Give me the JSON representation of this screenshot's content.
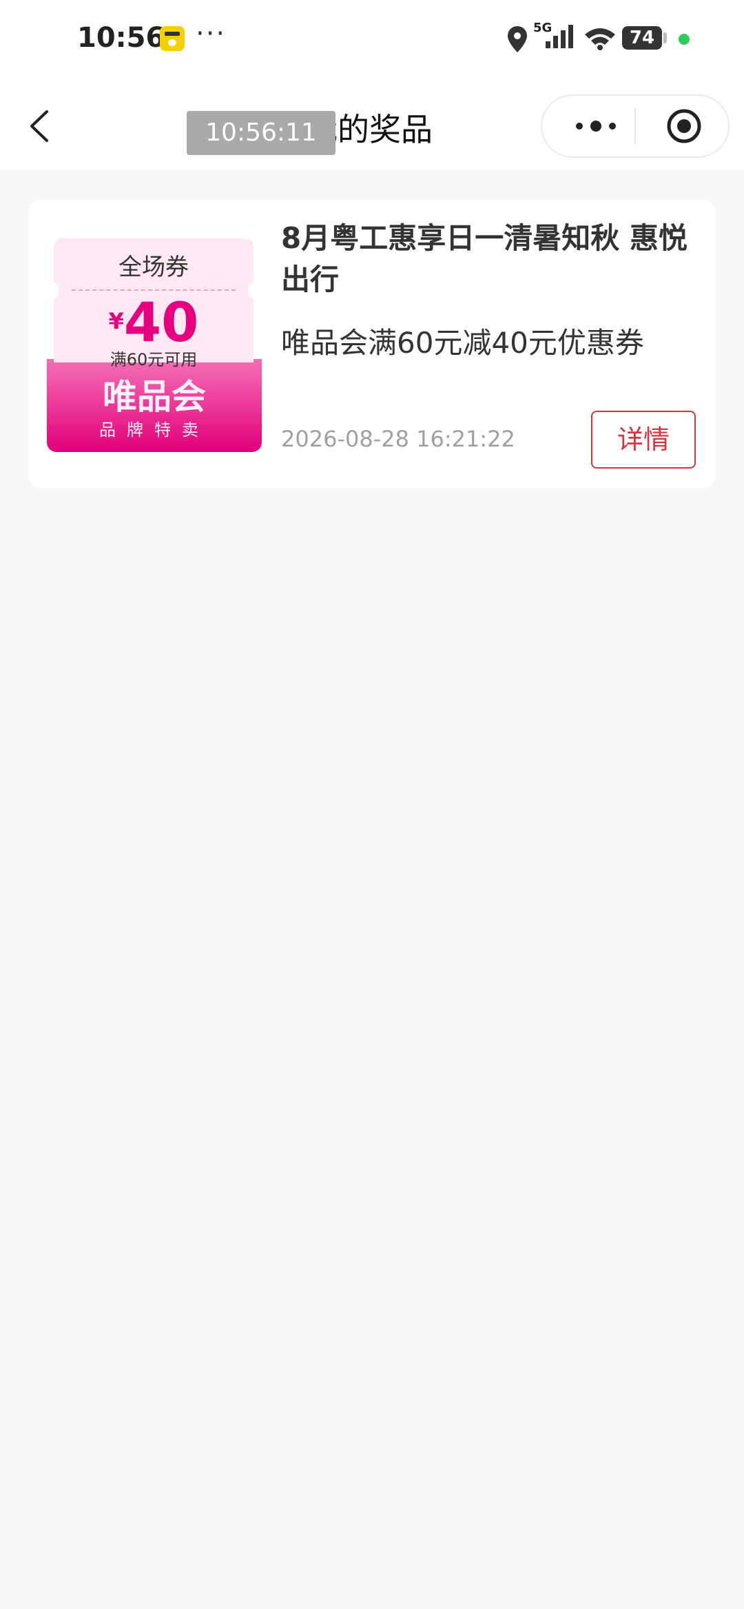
{
  "status_bar": {
    "time": "10:56",
    "more": "···",
    "network": "5G",
    "battery": "74"
  },
  "nav": {
    "time_overlay": "10:56:11",
    "title": "我的奖品"
  },
  "prize": {
    "title": "8月粤工惠享日一清暑知秋 惠悦出行",
    "description": "唯品会满60元减40元优惠券",
    "date": "2026-08-28 16:21:22",
    "detail_label": "详情",
    "coupon": {
      "type": "全场券",
      "currency": "¥",
      "amount": "40",
      "condition": "满60元可用",
      "brand": "唯品会",
      "slogan": "品牌特卖"
    }
  },
  "colors": {
    "accent_red": "#d8343f",
    "coupon_pink": "#e4007f",
    "background": "#f7f7f7"
  }
}
